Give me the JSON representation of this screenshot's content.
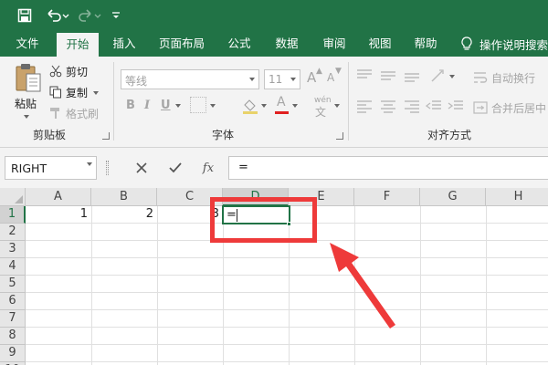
{
  "colors": {
    "brand": "#217346",
    "annotation": "#ee3a3a"
  },
  "quick_access": {
    "save_icon": "save-icon",
    "undo_icon": "undo-icon",
    "redo_icon": "redo-icon",
    "customize_icon": "customize-dropdown-icon"
  },
  "tabs": [
    {
      "label": "文件"
    },
    {
      "label": "开始",
      "active": true
    },
    {
      "label": "插入"
    },
    {
      "label": "页面布局"
    },
    {
      "label": "公式"
    },
    {
      "label": "数据"
    },
    {
      "label": "审阅"
    },
    {
      "label": "视图"
    },
    {
      "label": "帮助"
    }
  ],
  "tell_me": {
    "label": "操作说明搜索",
    "icon": "lightbulb-icon"
  },
  "clipboard": {
    "paste_label": "粘贴",
    "cut_label": "剪切",
    "copy_label": "复制",
    "format_painter_label": "格式刷",
    "group_label": "剪贴板"
  },
  "font": {
    "font_name": "等线",
    "font_size": "11",
    "grow_font": "A",
    "shrink_font": "A",
    "bold": "B",
    "italic": "I",
    "underline": "U",
    "font_color": "A",
    "phonetic": "wén",
    "phonetic_char": "文",
    "group_label": "字体"
  },
  "alignment": {
    "wrap_text_label": "自动换行",
    "merge_center_label": "合并后居中",
    "group_label": "对齐方式"
  },
  "formula_bar": {
    "name_box": "RIGHT",
    "cancel_icon": "cancel-icon",
    "enter_icon": "check-icon",
    "fx_label": "fx",
    "formula": "="
  },
  "columns": [
    "A",
    "B",
    "C",
    "D",
    "E",
    "F",
    "G",
    "H"
  ],
  "rows": [
    "1",
    "2",
    "3",
    "4",
    "5",
    "6",
    "7",
    "8",
    "9",
    "10"
  ],
  "cells": {
    "A1": "1",
    "B1": "2",
    "C1": "3",
    "D1": "="
  },
  "active_cell": "D1",
  "annotation": {
    "type": "red-highlight-box-and-arrow",
    "target": "D1"
  }
}
